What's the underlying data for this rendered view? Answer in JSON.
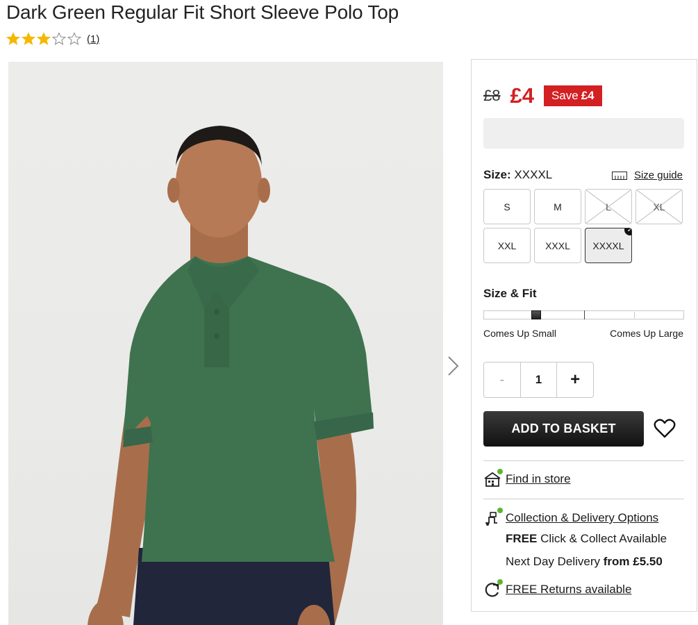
{
  "product": {
    "title": "Dark Green Regular Fit Short Sleeve Polo Top",
    "rating": 3,
    "rating_max": 5,
    "review_count": "(1)"
  },
  "pricing": {
    "old_price": "£8",
    "new_price": "£4",
    "save_label": "Save",
    "save_amount": "£4"
  },
  "size": {
    "label": "Size:",
    "selected": "XXXXL",
    "guide_label": "Size guide",
    "options": [
      {
        "label": "S",
        "available": true
      },
      {
        "label": "M",
        "available": true
      },
      {
        "label": "L",
        "available": false
      },
      {
        "label": "XL",
        "available": false
      },
      {
        "label": "XXL",
        "available": true
      },
      {
        "label": "XXXL",
        "available": true
      },
      {
        "label": "XXXXL",
        "available": true
      }
    ]
  },
  "fit": {
    "title": "Size & Fit",
    "low_label": "Comes Up Small",
    "high_label": "Comes Up Large",
    "position": 0.26
  },
  "quantity": {
    "minus": "-",
    "value": "1",
    "plus": "+"
  },
  "basket": {
    "add_label": "ADD TO BASKET"
  },
  "store": {
    "find_label": "Find in store"
  },
  "delivery": {
    "options_label": "Collection & Delivery Options",
    "click_collect_bold": "FREE",
    "click_collect_rest": " Click & Collect Available",
    "next_day_text": "Next Day Delivery ",
    "next_day_bold": "from £5.50",
    "returns_label": "FREE Returns available"
  },
  "colors": {
    "sale_red": "#d32023",
    "status_green": "#5cb531",
    "shirt_green": "#3f7350"
  }
}
